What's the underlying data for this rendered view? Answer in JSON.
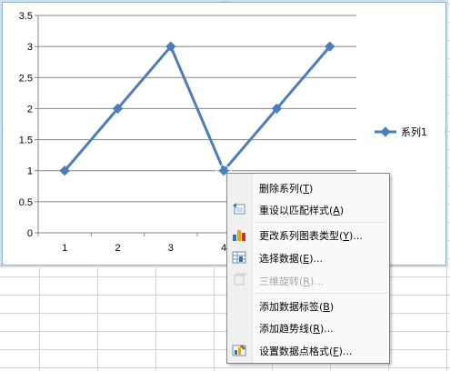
{
  "chart_data": {
    "type": "line",
    "x": [
      "1",
      "2",
      "3",
      "4",
      "5",
      "6"
    ],
    "series": [
      {
        "name": "系列1",
        "values": [
          1,
          2,
          3,
          1,
          2,
          3
        ],
        "color": "#4a7ebb"
      }
    ],
    "yticks": [
      "3.5",
      "3",
      "2.5",
      "2",
      "1.5",
      "1",
      "0.5",
      "0"
    ],
    "xticks": [
      "1",
      "2",
      "3",
      "4"
    ],
    "ylim": [
      0,
      3.5
    ],
    "grid": true,
    "legend_position": "right",
    "legend": [
      "系列1"
    ]
  },
  "context_menu": {
    "items": [
      {
        "label": "删除系列",
        "hotkey": "T",
        "icon": "none",
        "disabled": false
      },
      {
        "label": "重设以匹配样式",
        "hotkey": "A",
        "icon": "reset-style-icon",
        "disabled": false
      },
      {
        "label": "更改系列图表类型",
        "hotkey": "Y",
        "suffix": "...",
        "icon": "change-chart-type-icon",
        "disabled": false
      },
      {
        "label": "选择数据",
        "hotkey": "E",
        "suffix": "...",
        "icon": "select-data-icon",
        "disabled": false
      },
      {
        "label": "三维旋转",
        "hotkey": "R",
        "suffix": "...",
        "icon": "3d-rotation-icon",
        "disabled": true
      },
      {
        "label": "添加数据标签",
        "hotkey": "B",
        "icon": "none",
        "disabled": false
      },
      {
        "label": "添加趋势线",
        "hotkey": "R",
        "suffix": "...",
        "icon": "none",
        "disabled": false
      },
      {
        "label": "设置数据点格式",
        "hotkey": "F",
        "suffix": "...",
        "icon": "format-data-point-icon",
        "disabled": false
      }
    ]
  },
  "colors": {
    "series_line": "#4a7ebb",
    "gridline": "#868686",
    "axis": "#868686",
    "chart_border": "#8fb0c9"
  }
}
